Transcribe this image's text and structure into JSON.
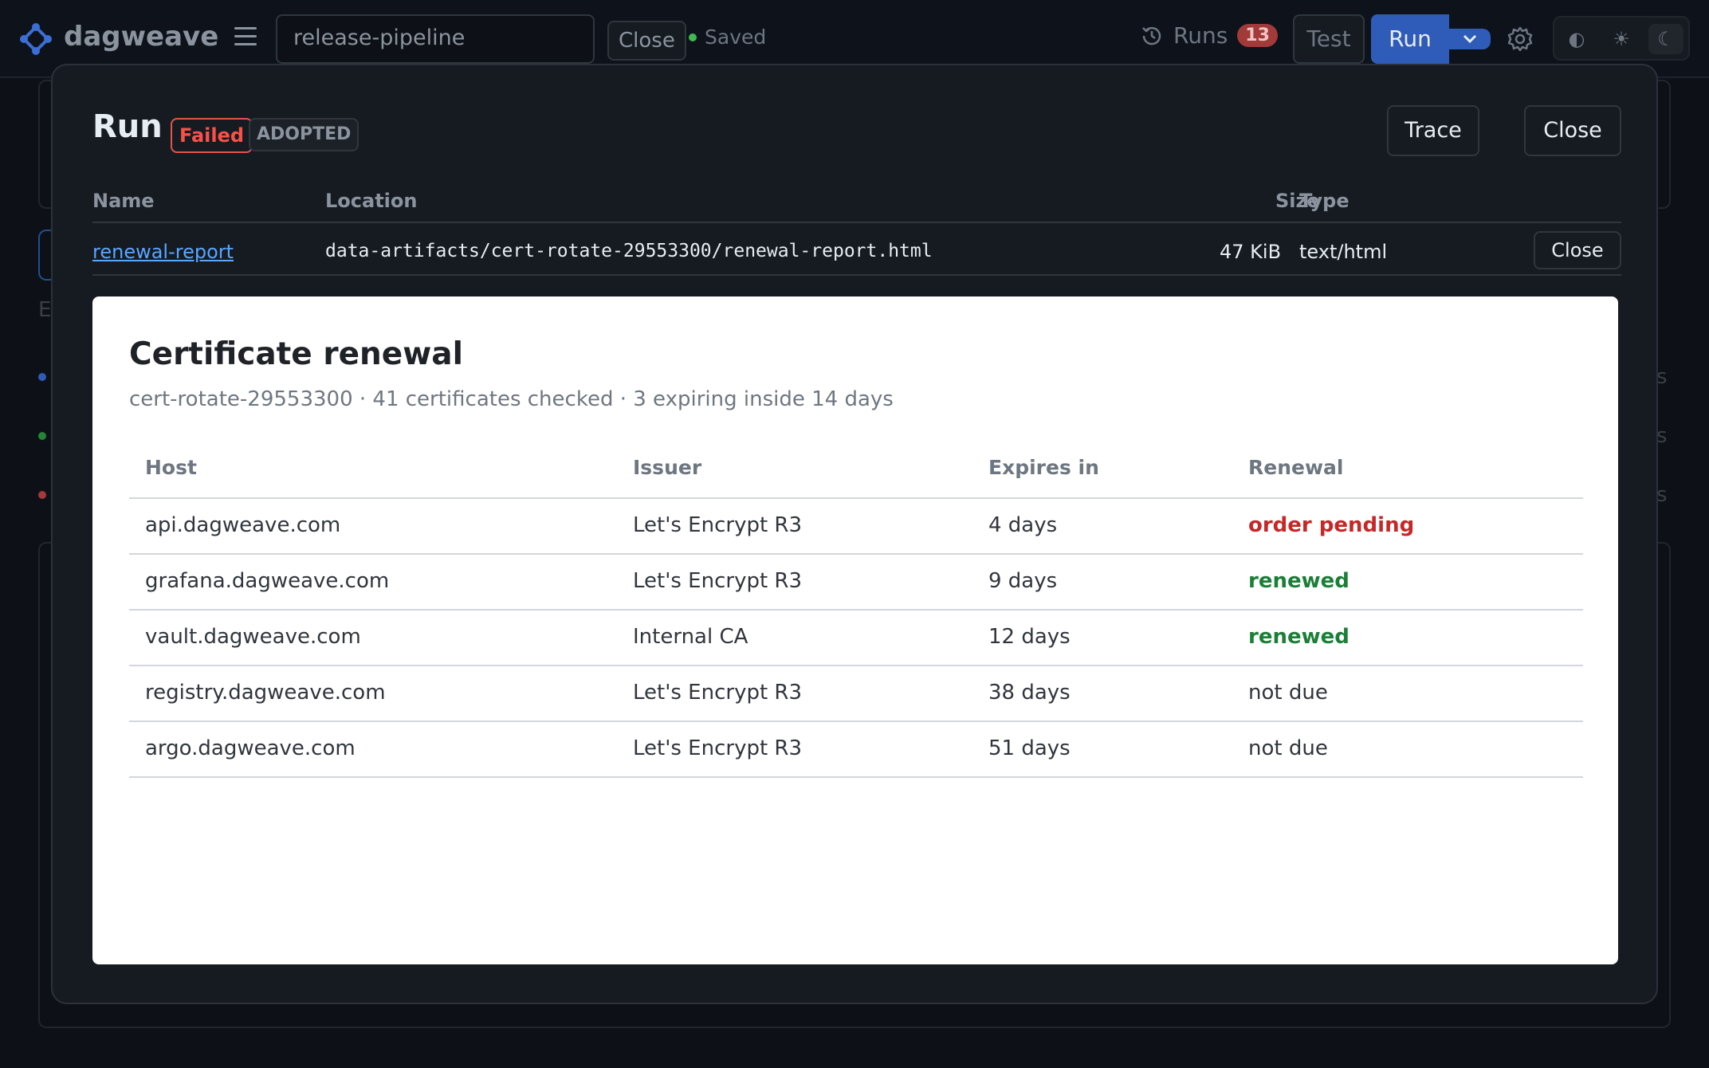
{
  "topbar": {
    "brand": "dagweave",
    "pipeline_name": "release-pipeline",
    "close_label": "Close",
    "saved_label": "Saved",
    "runs_label": "Runs",
    "runs_count": "13",
    "test_label": "Test",
    "run_label": "Run",
    "theme_modes": [
      "auto",
      "light",
      "dark"
    ]
  },
  "background": {
    "heading_fragment": "E",
    "row_tails": [
      "s",
      "s",
      "s"
    ]
  },
  "modal": {
    "title": "Run",
    "status_badge": "Failed",
    "adopted_badge": "ADOPTED",
    "trace_label": "Trace",
    "close_label": "Close",
    "artifact_columns": {
      "name": "Name",
      "location": "Location",
      "size": "Size",
      "type": "Type"
    },
    "artifact": {
      "name": "renewal-report",
      "location": "data-artifacts/cert-rotate-29553300/renewal-report.html",
      "size": "47 KiB",
      "type": "text/html",
      "close_label": "Close"
    }
  },
  "report": {
    "title": "Certificate renewal",
    "subtitle": "cert-rotate-29553300 · 41 certificates checked · 3 expiring inside 14 days",
    "columns": {
      "host": "Host",
      "issuer": "Issuer",
      "expires": "Expires in",
      "renewal": "Renewal"
    },
    "rows": [
      {
        "host": "api.dagweave.com",
        "issuer": "Let's Encrypt R3",
        "expires": "4 days",
        "renewal": "order pending",
        "status": "pending"
      },
      {
        "host": "grafana.dagweave.com",
        "issuer": "Let's Encrypt R3",
        "expires": "9 days",
        "renewal": "renewed",
        "status": "renewed"
      },
      {
        "host": "vault.dagweave.com",
        "issuer": "Internal CA",
        "expires": "12 days",
        "renewal": "renewed",
        "status": "renewed"
      },
      {
        "host": "registry.dagweave.com",
        "issuer": "Let's Encrypt R3",
        "expires": "38 days",
        "renewal": "not due",
        "status": "notdue"
      },
      {
        "host": "argo.dagweave.com",
        "issuer": "Let's Encrypt R3",
        "expires": "51 days",
        "renewal": "not due",
        "status": "notdue"
      }
    ]
  },
  "colors": {
    "accent": "#2f5cb8",
    "failed": "#f85149",
    "pending": "#c62828",
    "renewed": "#1a7f37",
    "link": "#58a6ff"
  }
}
